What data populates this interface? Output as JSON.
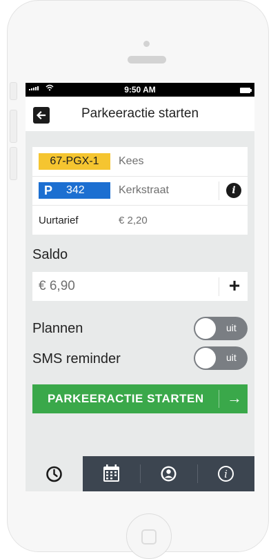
{
  "status_bar": {
    "time": "9:50 AM"
  },
  "header": {
    "title": "Parkeeractie starten"
  },
  "vehicle": {
    "plate": "67-PGX-1",
    "name": "Kees"
  },
  "zone": {
    "p_symbol": "P",
    "number": "342",
    "street": "Kerkstraat"
  },
  "tariff": {
    "label": "Uurtarief",
    "value": "€ 2,20"
  },
  "saldo": {
    "label": "Saldo",
    "value": "€ 6,90"
  },
  "plannen": {
    "label": "Plannen",
    "state": "uit"
  },
  "sms": {
    "label": "SMS reminder",
    "state": "uit"
  },
  "start_button": {
    "label": "PARKEERACTIE STARTEN"
  },
  "tabs": [
    {
      "icon": "clock-icon",
      "active": true
    },
    {
      "icon": "calendar-icon",
      "active": false
    },
    {
      "icon": "user-icon",
      "active": false
    },
    {
      "icon": "info-icon",
      "active": false
    }
  ],
  "colors": {
    "plate_yellow": "#f5c530",
    "zone_blue": "#1c6fd1",
    "start_green": "#3aa84a",
    "tabbar_dark": "#3c4550",
    "toggle_gray": "#7a7e83"
  }
}
